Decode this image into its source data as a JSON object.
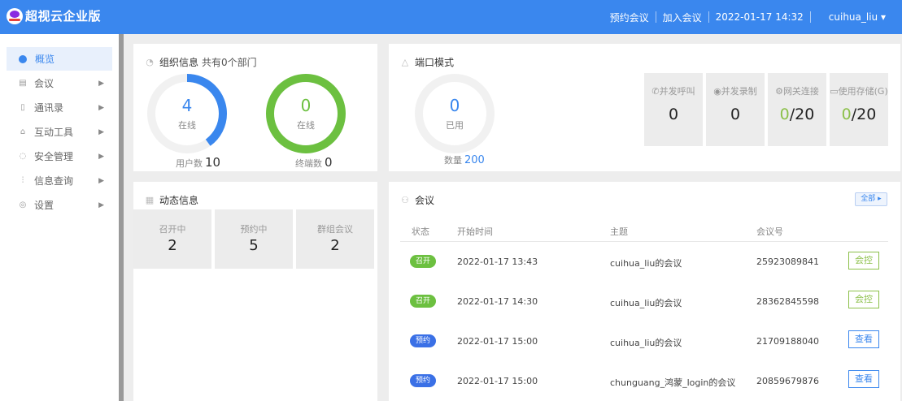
{
  "header": {
    "app_name": "超视云企业版",
    "schedule_meeting": "预约会议",
    "join_meeting": "加入会议",
    "datetime": "2022-01-17 14:32",
    "user": "cuihua_liu ▾"
  },
  "sidebar": {
    "items": [
      {
        "label": "概览"
      },
      {
        "label": "会议"
      },
      {
        "label": "通讯录"
      },
      {
        "label": "互动工具"
      },
      {
        "label": "安全管理"
      },
      {
        "label": "信息查询"
      },
      {
        "label": "设置"
      }
    ]
  },
  "org": {
    "title": "组织信息",
    "subtitle": "共有0个部门",
    "users_online": "4",
    "users_online_label": "在线",
    "users_online_fraction": 0.4,
    "users_total_label": "用户数",
    "users_total": "10",
    "terminals_online": "0",
    "terminals_online_label": "在线",
    "terminals_total_label": "终端数",
    "terminals_total": "0"
  },
  "port": {
    "title": "端口模式",
    "used": "0",
    "used_label": "已用",
    "count_label": "数量",
    "count": "200",
    "stats": [
      {
        "label": "并发呼叫",
        "value_main": "0",
        "value_suffix": ""
      },
      {
        "label": "并发录制",
        "value_main": "0",
        "value_suffix": ""
      },
      {
        "label": "网关连接",
        "value_main": "0",
        "value_suffix": "/20"
      },
      {
        "label": "使用存储(G)",
        "value_main": "0",
        "value_suffix": "/20"
      }
    ]
  },
  "dynamic": {
    "title": "动态信息",
    "stats": [
      {
        "label": "召开中",
        "value": "2"
      },
      {
        "label": "预约中",
        "value": "5"
      },
      {
        "label": "群组会议",
        "value": "2"
      }
    ]
  },
  "meetings": {
    "title": "会议",
    "all_button": "全部 ▸",
    "columns": [
      "状态",
      "开始时间",
      "主题",
      "会议号"
    ],
    "rows": [
      {
        "status": "召开",
        "start": "2022-01-17 13:43",
        "topic": "cuihua_liu的会议",
        "number": "25923089841",
        "action": "会控"
      },
      {
        "status": "召开",
        "start": "2022-01-17 14:30",
        "topic": "cuihua_liu的会议",
        "number": "28362845598",
        "action": "会控"
      },
      {
        "status": "预约",
        "start": "2022-01-17 15:00",
        "topic": "cuihua_liu的会议",
        "number": "21709188040",
        "action": "查看"
      },
      {
        "status": "预约",
        "start": "2022-01-17 15:00",
        "topic": "chunguang_鸿蒙_login的会议",
        "number": "20859679876",
        "action": "查看"
      }
    ]
  },
  "colors": {
    "brand": "#3a87ee",
    "green": "#6cc040",
    "ring_bg": "#f1f1f1"
  }
}
